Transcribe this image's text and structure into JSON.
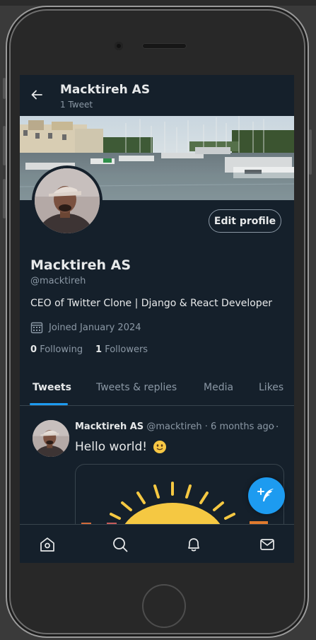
{
  "header": {
    "name": "Macktireh AS",
    "tweet_count": "1 Tweet"
  },
  "profile": {
    "name": "Macktireh AS",
    "handle": "@macktireh",
    "bio": "CEO of Twitter Clone | Django & React Developer",
    "joined": "Joined January 2024",
    "following_count": "0",
    "following_label": "Following",
    "followers_count": "1",
    "followers_label": "Followers",
    "edit_label": "Edit profile"
  },
  "tabs": [
    {
      "label": "Tweets",
      "active": true
    },
    {
      "label": "Tweets & replies",
      "active": false
    },
    {
      "label": "Media",
      "active": false
    },
    {
      "label": "Likes",
      "active": false
    }
  ],
  "tweet": {
    "author": "Macktireh AS",
    "handle": "@macktireh",
    "separator": "·",
    "time": "6 months ago",
    "text": "Hello world!",
    "more": "···"
  },
  "bottom_nav": [
    "home-icon",
    "search-icon",
    "bell-icon",
    "mail-icon"
  ],
  "colors": {
    "background": "#15202b",
    "accent": "#1d9bf0",
    "text": "#e7e9ea",
    "muted": "#8b98a5",
    "border": "#38444d"
  }
}
